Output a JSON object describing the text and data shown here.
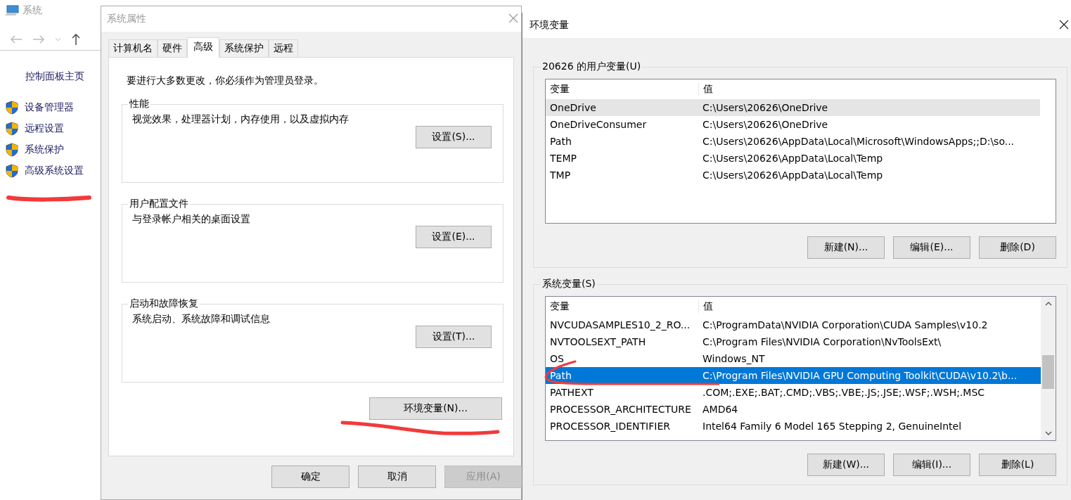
{
  "background_window": {
    "title": "系统",
    "home_link": "控制面板主页",
    "links": [
      {
        "label": "设备管理器"
      },
      {
        "label": "远程设置"
      },
      {
        "label": "系统保护"
      },
      {
        "label": "高级系统设置"
      }
    ]
  },
  "system_properties": {
    "title": "系统属性",
    "tabs": [
      {
        "label": "计算机名",
        "selected": false
      },
      {
        "label": "硬件",
        "selected": false
      },
      {
        "label": "高级",
        "selected": true
      },
      {
        "label": "系统保护",
        "selected": false
      },
      {
        "label": "远程",
        "selected": false
      }
    ],
    "notice": "要进行大多数更改，你必须作为管理员登录。",
    "groups": [
      {
        "title": "性能",
        "description": "视觉效果，处理器计划，内存使用，以及虚拟内存",
        "button": "设置(S)..."
      },
      {
        "title": "用户配置文件",
        "description": "与登录帐户相关的桌面设置",
        "button": "设置(E)..."
      },
      {
        "title": "启动和故障恢复",
        "description": "系统启动、系统故障和调试信息",
        "button": "设置(T)..."
      }
    ],
    "env_button": "环境变量(N)...",
    "buttons": [
      {
        "label": "确定",
        "disabled": false
      },
      {
        "label": "取消",
        "disabled": false
      },
      {
        "label": "应用(A)",
        "disabled": true
      }
    ]
  },
  "environment_variables": {
    "title": "环境变量",
    "sections": [
      {
        "title": "20626 的用户变量(U)",
        "focused": false,
        "scrollbar": false,
        "columns": [
          "变量",
          "值"
        ],
        "rows": [
          {
            "name": "OneDrive",
            "value": "C:\\Users\\20626\\OneDrive",
            "selected": true
          },
          {
            "name": "OneDriveConsumer",
            "value": "C:\\Users\\20626\\OneDrive",
            "selected": false
          },
          {
            "name": "Path",
            "value": "C:\\Users\\20626\\AppData\\Local\\Microsoft\\WindowsApps;;D:\\so...",
            "selected": false
          },
          {
            "name": "TEMP",
            "value": "C:\\Users\\20626\\AppData\\Local\\Temp",
            "selected": false
          },
          {
            "name": "TMP",
            "value": "C:\\Users\\20626\\AppData\\Local\\Temp",
            "selected": false
          }
        ],
        "buttons": [
          "新建(N)...",
          "编辑(E)...",
          "删除(D)"
        ]
      },
      {
        "title": "系统变量(S)",
        "focused": true,
        "scrollbar": true,
        "columns": [
          "变量",
          "值"
        ],
        "rows": [
          {
            "name": "NVCUDASAMPLES10_2_RO...",
            "value": "C:\\ProgramData\\NVIDIA Corporation\\CUDA Samples\\v10.2",
            "selected": false
          },
          {
            "name": "NVTOOLSEXT_PATH",
            "value": "C:\\Program Files\\NVIDIA Corporation\\NvToolsExt\\",
            "selected": false
          },
          {
            "name": "OS",
            "value": "Windows_NT",
            "selected": false
          },
          {
            "name": "Path",
            "value": "C:\\Program Files\\NVIDIA GPU Computing Toolkit\\CUDA\\v10.2\\b...",
            "selected": true
          },
          {
            "name": "PATHEXT",
            "value": ".COM;.EXE;.BAT;.CMD;.VBS;.VBE;.JS;.JSE;.WSF;.WSH;.MSC",
            "selected": false
          },
          {
            "name": "PROCESSOR_ARCHITECTURE",
            "value": "AMD64",
            "selected": false
          },
          {
            "name": "PROCESSOR_IDENTIFIER",
            "value": "Intel64 Family 6 Model 165 Stepping 2, GenuineIntel",
            "selected": false
          }
        ],
        "buttons": [
          "新建(W)...",
          "编辑(I)...",
          "删除(L)"
        ]
      }
    ]
  }
}
